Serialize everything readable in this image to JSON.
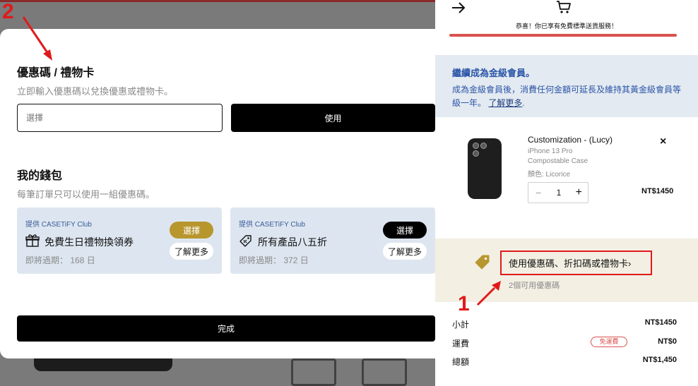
{
  "modal": {
    "title": "優惠碼 / 禮物卡",
    "subtitle": "立即輸入優惠碼以兌換優惠或禮物卡。",
    "input_placeholder": "選擇",
    "use_button": "使用",
    "wallet_title": "我的錢包",
    "wallet_subtitle": "每筆訂單只可以使用一組優惠碼。",
    "coupons": [
      {
        "provider": "提供 CASETiFY Club",
        "icon": "gift-icon",
        "name": "免費生日禮物換領券",
        "expiry": "即將過期： 168 日",
        "select_label": "選擇",
        "select_color": "#b8962e",
        "more_label": "了解更多"
      },
      {
        "provider": "提供 CASETiFY Club",
        "icon": "discount-tag-icon",
        "name": "所有產品八五折",
        "expiry": "即將過期： 372 日",
        "select_label": "選擇",
        "select_color": "#000000",
        "more_label": "了解更多"
      }
    ],
    "done_button": "完成"
  },
  "cart": {
    "header_icons": [
      "arrow-right-icon",
      "cart-icon"
    ],
    "shipping_message": "恭喜！你已享有免費標準送貨服務！",
    "shipping_progress": 1.0,
    "membership": {
      "title": "繼續成為金級會員。",
      "description": "成為金級會員後，消費任何金額可延長及維持其黃金級會員等級一年。",
      "learn_more": "了解更多",
      "trailing": "."
    },
    "item": {
      "name": "Customization - (Lucy)",
      "model": "iPhone 13 Pro",
      "type": "Compostable Case",
      "color": "顏色: Licorice",
      "quantity": "1",
      "minus": "−",
      "plus": "+",
      "remove": "×",
      "price": "NT$1450"
    },
    "promo": {
      "link": "使用優惠碼、折扣碼或禮物卡",
      "chevron": "›",
      "available": "2個可用優惠碼"
    },
    "summary": {
      "subtotal_label": "小計",
      "subtotal": "NT$1450",
      "shipping_label": "運費",
      "shipping_badge": "免運費",
      "shipping": "NT$0",
      "total_label": "總額",
      "total": "NT$1,450"
    }
  },
  "annotations": {
    "step1": "1",
    "step2": "2",
    "color": "#e01a1a"
  }
}
